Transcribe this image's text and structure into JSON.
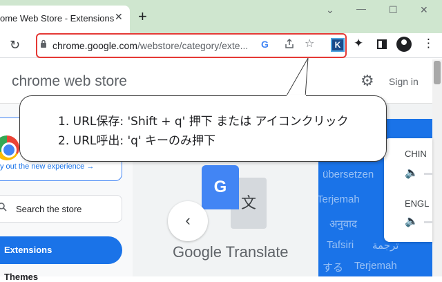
{
  "browser": {
    "tab_title": "ome Web Store - Extensions",
    "tab_close": "✕",
    "new_tab": "+",
    "window_controls": {
      "collapse": "⌄",
      "minimize": "—",
      "maximize": "☐",
      "close": "✕"
    },
    "url_host": "chrome.google.com",
    "url_path": "/webstore/category/exte...",
    "reload_icon": "↻",
    "google_letter": "G",
    "extension_letter": "K"
  },
  "store": {
    "title": "chrome web store",
    "sign_in": "Sign in",
    "promo_link": "y out the new experience →",
    "search_placeholder": "Search the store",
    "nav_extensions": "Extensions",
    "nav_themes": "Themes"
  },
  "feature": {
    "translate_name": "Google Translate",
    "g_letter": "G",
    "wen_char": "文",
    "prev_arrow": "‹",
    "background_words": [
      "übersetzen",
      "Terjemah",
      "अनुवाद",
      "Tafsiri",
      "ترجمة",
      "する",
      "Terjemah"
    ],
    "lang1": "CHIN",
    "lang2": "ENGL"
  },
  "callout": {
    "line1": "1. URL保存: 'Shift + q' 押下 または アイコンクリック",
    "line2": "2. URL呼出: 'q' キーのみ押下"
  },
  "colors": {
    "accent": "#1a73e8",
    "highlight_border": "#e53935",
    "tabstrip": "#cfe6cf"
  }
}
